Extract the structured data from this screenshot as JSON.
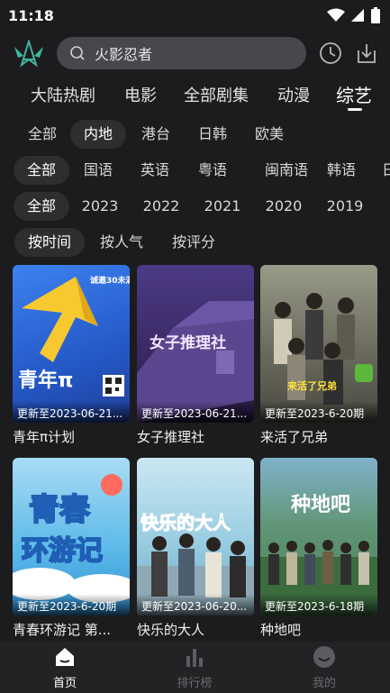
{
  "status_bar": {
    "time": "11:18"
  },
  "search": {
    "placeholder": "火影忍者"
  },
  "category_tabs": [
    {
      "label": "大陆热剧",
      "active": false
    },
    {
      "label": "电影",
      "active": false
    },
    {
      "label": "全部剧集",
      "active": false
    },
    {
      "label": "动漫",
      "active": false
    },
    {
      "label": "综艺",
      "active": true
    }
  ],
  "filters": {
    "region": [
      "全部",
      "内地",
      "港台",
      "日韩",
      "欧美"
    ],
    "region_selected": "内地",
    "language": [
      "全部",
      "国语",
      "英语",
      "粤语",
      "闽南语",
      "韩语"
    ],
    "language_selected": "全部",
    "year": [
      "全部",
      "2023",
      "2022",
      "2021",
      "2020",
      "2019"
    ],
    "year_selected": "全部",
    "sort": [
      "按时间",
      "按人气",
      "按评分"
    ],
    "sort_selected": "按时间"
  },
  "shows": [
    {
      "title": "青年π计划",
      "update": "更新至2023-06-21...",
      "poster_color": "#2f6fe0"
    },
    {
      "title": "女子推理社",
      "update": "更新至2023-06-21...",
      "poster_color": "#3a2a63"
    },
    {
      "title": "来活了兄弟",
      "update": "更新至2023-6-20期",
      "poster_color": "#6a6a5e"
    },
    {
      "title": "青春环游记 第...",
      "update": "更新至2023-6-20期",
      "poster_color": "#5ab8e8"
    },
    {
      "title": "快乐的大人",
      "update": "更新至2023-06-20...",
      "poster_color": "#79b9d9"
    },
    {
      "title": "种地吧",
      "update": "更新至2023-6-18期",
      "poster_color": "#4d7f5a"
    }
  ],
  "poster_art": {
    "p1": "青年π",
    "p2": "女子推理社",
    "p3": "来活了兄弟",
    "p4a": "青春",
    "p4b": "环游记",
    "p5": "快乐的大人",
    "p6": "种地吧"
  },
  "bottom_nav": [
    {
      "label": "首页",
      "icon": "home-icon",
      "active": true
    },
    {
      "label": "排行榜",
      "icon": "chart-icon",
      "active": false
    },
    {
      "label": "我的",
      "icon": "profile-icon",
      "active": false
    }
  ],
  "colors": {
    "background": "#1c1c1e",
    "chip_selected": "#2e2e31",
    "search_bg": "#48484c"
  }
}
